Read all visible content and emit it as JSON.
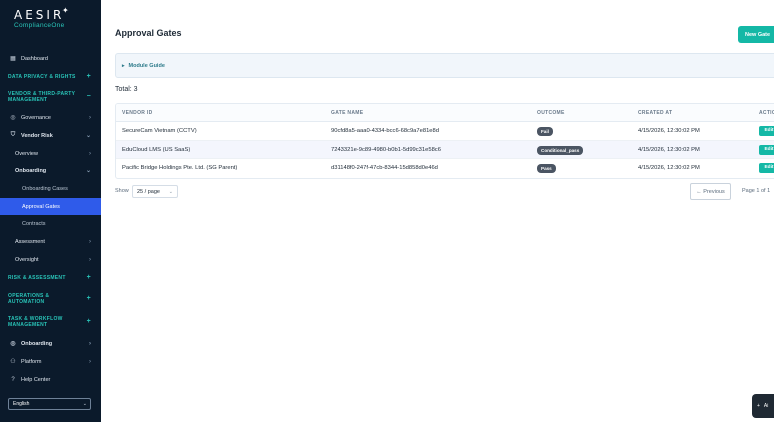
{
  "brand": {
    "name": "AESIR",
    "sub": "ComplianceOne"
  },
  "sidebar": {
    "items": [
      {
        "label": "Dashboard"
      },
      {
        "label": "DATA PRIVACY & RIGHTS"
      },
      {
        "label": "VENDOR & THIRD-PARTY MANAGEMENT"
      },
      {
        "label": "Governance"
      },
      {
        "label": "Vendor Risk"
      },
      {
        "label": "Overview"
      },
      {
        "label": "Onboarding"
      },
      {
        "label": "Onboarding Cases"
      },
      {
        "label": "Approval Gates"
      },
      {
        "label": "Contracts"
      },
      {
        "label": "Assessment"
      },
      {
        "label": "Oversight"
      },
      {
        "label": "RISK & ASSESSMENT"
      },
      {
        "label": "OPERATIONS & AUTOMATION"
      },
      {
        "label": "TASK & WORKFLOW MANAGEMENT"
      },
      {
        "label": "Onboarding"
      },
      {
        "label": "Platform"
      },
      {
        "label": "Help Center"
      }
    ],
    "language": "English"
  },
  "page": {
    "title": "Approval Gates",
    "new_button": "New Gate",
    "guide": "Module Guide",
    "total": "Total: 3"
  },
  "table": {
    "columns": [
      "VENDOR ID",
      "GATE NAME",
      "OUTCOME",
      "CREATED AT",
      "ACTIO"
    ],
    "rows": [
      {
        "vendor": "SecureCam Vietnam (CCTV)",
        "gate": "90cfd8a5-aaa0-4334-bcc6-68c9a7e81e8d",
        "outcome": "Fail",
        "created": "4/15/2026, 12:30:02 PM",
        "action": "Edit"
      },
      {
        "vendor": "EduCloud LMS (US SaaS)",
        "gate": "7243321e-9c89-4980-b0b1-5d99c31e58c6",
        "outcome": "Conditional_pass",
        "created": "4/15/2026, 12:30:02 PM",
        "action": "Edit"
      },
      {
        "vendor": "Pacific Bridge Holdings Pte. Ltd. (SG Parent)",
        "gate": "d31148f0-247f-47cb-8344-15d858d0e46d",
        "outcome": "Pass",
        "created": "4/15/2026, 12:30:02 PM",
        "action": "Edit"
      }
    ]
  },
  "pagination": {
    "show_label": "Show",
    "page_size": "25 / page",
    "previous": "← Previous",
    "page_info": "Page 1 of 1"
  },
  "floating": {
    "label": "Ai"
  },
  "colors": {
    "sidebar_bg": "#0b1a2b",
    "accent": "#14b8a6",
    "active": "#2f5bea",
    "section": "#29c4b8"
  }
}
